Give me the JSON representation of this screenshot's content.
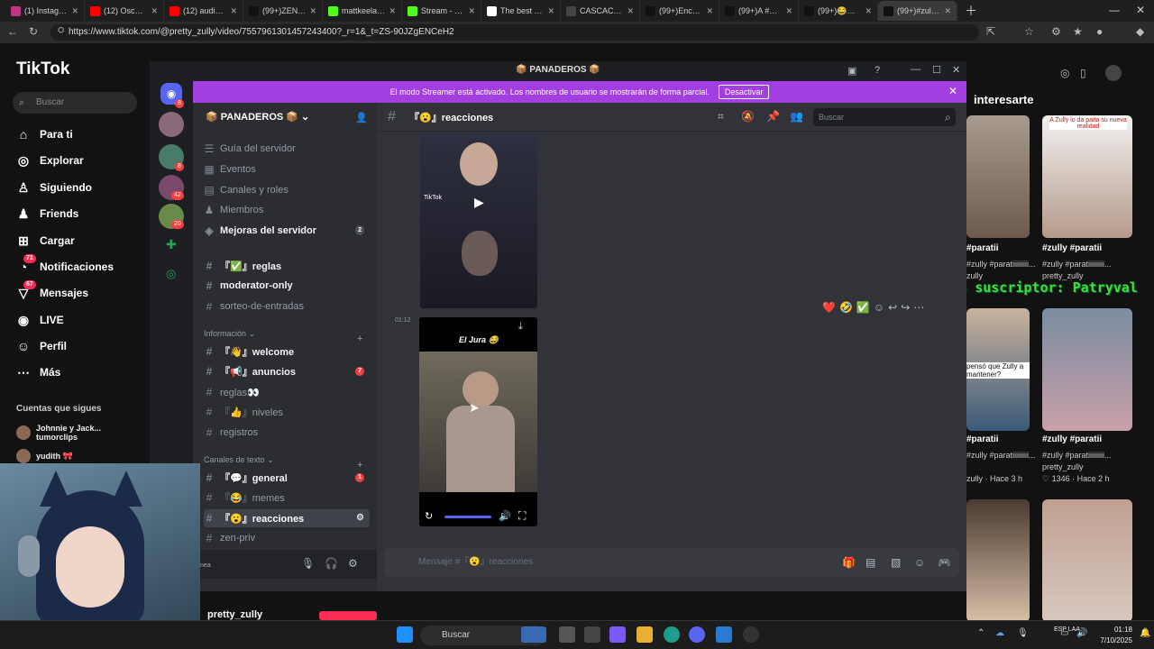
{
  "browser": {
    "tabs": [
      {
        "label": "(1) Instagram",
        "color": "#c13584"
      },
      {
        "label": "(12) Oscar Ma",
        "color": "#ff0000"
      },
      {
        "label": "(12) audio FUl",
        "color": "#ff0000"
      },
      {
        "label": "(99+)ZENFLUI",
        "color": "#111111"
      },
      {
        "label": "mattkeelan - ",
        "color": "#53fc18"
      },
      {
        "label": "Stream - Kick",
        "color": "#53fc18"
      },
      {
        "label": "The best Chat",
        "color": "#ffffff"
      },
      {
        "label": "CASCACA BEA",
        "color": "#444444"
      },
      {
        "label": "(99+)Encuent",
        "color": "#111111"
      },
      {
        "label": "(99+)A #mile",
        "color": "#111111"
      },
      {
        "label": "(99+)😂😂😂",
        "color": "#111111"
      },
      {
        "label": "(99+)#zully #",
        "color": "#111111"
      }
    ],
    "url": "https://www.tiktok.com/@pretty_zully/video/7557961301457243400?_r=1&_t=ZS-90JZgENCeH2"
  },
  "tiktok": {
    "logo": "TikTok",
    "search_placeholder": "Buscar",
    "nav": [
      {
        "label": "Para ti",
        "icon": "home-icon"
      },
      {
        "label": "Explorar",
        "icon": "compass-icon"
      },
      {
        "label": "Siguiendo",
        "icon": "following-icon"
      },
      {
        "label": "Friends",
        "icon": "friends-icon"
      },
      {
        "label": "Cargar",
        "icon": "upload-icon"
      },
      {
        "label": "Notificaciones",
        "icon": "bell-icon",
        "badge": "71"
      },
      {
        "label": "Mensajes",
        "icon": "message-icon",
        "badge": "67"
      },
      {
        "label": "LIVE",
        "icon": "live-icon"
      },
      {
        "label": "Perfil",
        "icon": "profile-icon"
      },
      {
        "label": "Más",
        "icon": "more-icon"
      }
    ],
    "following_heading": "Cuentas que sigues",
    "following": [
      {
        "name": "Johnnie y Jack... tumorclips"
      },
      {
        "name": "yudith 🎀"
      }
    ],
    "right_heading": "interesarte",
    "videos": [
      {
        "caption": "#paratii",
        "sub": "zully",
        "overlay": ""
      },
      {
        "caption": "#zully #paratii",
        "sub": "pretty_zully",
        "overlay": "A Zully lo da paita su nueva realidad"
      },
      {
        "caption": "#paratii",
        "sub": "zully · Hace 3 h",
        "overlay": "pensó que Zully a mantener?"
      },
      {
        "caption": "#zully #paratii",
        "sub": "♡ 1346 · Hace 2 h",
        "overlay": ""
      }
    ],
    "videos_sub_b": "pretty_zully",
    "videos_caption_long": "#zully #paratiiiiiiiii...",
    "overlay_text": "último suscriptor: Patryval",
    "bottom_name": "pretty_zully"
  },
  "discord": {
    "window_title": "📦 PANADEROS 📦",
    "streamer_notice": "El modo Streamer está activado. Los nombres de usuario se mostrarán de forma parcial.",
    "streamer_button": "Desactivar",
    "server_name": "📦 PANADEROS 📦",
    "server_badges": [
      "8",
      "8",
      "42",
      "20"
    ],
    "top_items": [
      {
        "label": "Guía del servidor",
        "icon": "guide-icon"
      },
      {
        "label": "Eventos",
        "icon": "calendar-icon"
      },
      {
        "label": "Canales y roles",
        "icon": "roles-icon"
      },
      {
        "label": "Miembros",
        "icon": "members-icon"
      },
      {
        "label": "Mejoras del servidor",
        "icon": "boost-icon",
        "count": "2"
      }
    ],
    "channels_top": [
      {
        "label": "『✅』reglas",
        "bright": true
      },
      {
        "label": "moderator-only",
        "bright": true
      },
      {
        "label": "sorteo-de-entradas",
        "bright": false
      }
    ],
    "category_info": "Información ⌄",
    "channels_info": [
      {
        "label": "『👋』welcome",
        "bright": true,
        "badge": ""
      },
      {
        "label": "『📢』anuncios",
        "bright": true,
        "badge": "7"
      },
      {
        "label": "reglas👀",
        "bright": false,
        "badge": ""
      },
      {
        "label": "『👍』niveles",
        "bright": false,
        "badge": ""
      },
      {
        "label": "registros",
        "bright": false,
        "badge": ""
      }
    ],
    "category_text": "Canales de texto ⌄",
    "channels_text": [
      {
        "label": "『💬』general",
        "bright": true,
        "badge": "1"
      },
      {
        "label": "『😂』memes",
        "bright": false,
        "badge": ""
      },
      {
        "label": "『😮』reacciones",
        "bright": true,
        "badge": "",
        "selected": true
      },
      {
        "label": "zen-priv",
        "bright": false,
        "badge": ""
      }
    ],
    "channel_name": "『😮』reacciones",
    "search_placeholder": "Buscar",
    "message_time": "01:12",
    "media_caption": "El Jura 😂",
    "media_watermark": "TikTok",
    "reactions": [
      "❤️",
      "🤣",
      "✅"
    ],
    "message_placeholder": "Mensaje #『😮』reacciones",
    "userbar_status": "nea"
  },
  "taskbar": {
    "search_placeholder": "Buscar",
    "lang": "ESP LAA",
    "time": "01:18",
    "date": "7/10/2025"
  },
  "colors": {
    "discord_accent": "#a33fe0",
    "tiktok_red": "#fe2c55",
    "overlay_green": "#3be03b"
  }
}
